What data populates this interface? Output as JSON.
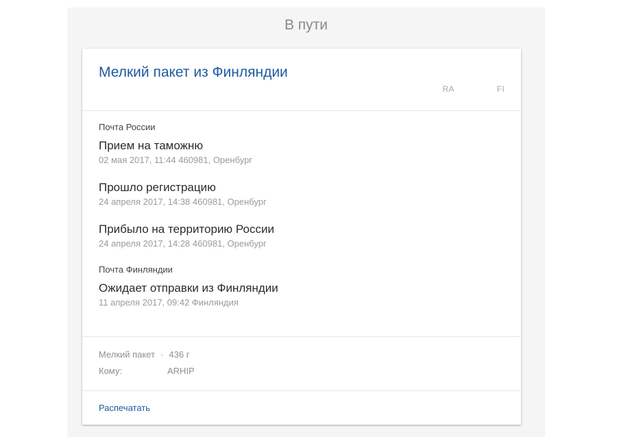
{
  "status_header": "В пути",
  "parcel": {
    "title": "Мелкий пакет из Финляндии",
    "tracking_prefix": "RA",
    "tracking_suffix": "FI"
  },
  "providers": [
    {
      "name": "Почта России",
      "events": [
        {
          "title": "Прием на таможню",
          "meta": "02 мая 2017, 11:44 460981, Оренбург"
        },
        {
          "title": "Прошло регистрацию",
          "meta": "24 апреля 2017, 14:38 460981, Оренбург"
        },
        {
          "title": "Прибыло на территорию России",
          "meta": "24 апреля 2017, 14:28 460981, Оренбург"
        }
      ]
    },
    {
      "name": "Почта Финляндии",
      "events": [
        {
          "title": "Ожидает отправки из Финляндии",
          "meta": "11 апреля 2017, 09:42 Финляндия"
        }
      ]
    }
  ],
  "details": {
    "type": "Мелкий пакет",
    "separator": "·",
    "weight": "436 г",
    "recipient_label": "Кому:",
    "recipient_name": "ARHIP"
  },
  "actions": {
    "print_label": "Распечатать"
  },
  "colors": {
    "accent": "#1f5a9e",
    "page_background": "#f5f5f5",
    "muted_text": "#9a9a9a"
  }
}
